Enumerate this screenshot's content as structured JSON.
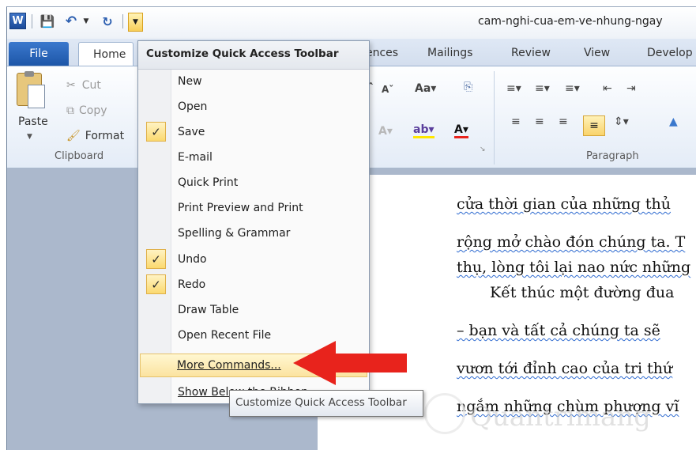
{
  "title_bar": {
    "doc_title": "cam-nghi-cua-em-ve-nhung-ngay"
  },
  "tabs": {
    "file": "File",
    "home": "Home",
    "references_partial": "ences",
    "mailings": "Mailings",
    "review": "Review",
    "view": "View",
    "developer_partial": "Develop"
  },
  "clipboard": {
    "paste": "Paste",
    "cut": "Cut",
    "copy": "Copy",
    "format": "Format",
    "group_label": "Clipboard"
  },
  "paragraph": {
    "group_label": "Paragraph"
  },
  "qat_menu": {
    "header": "Customize Quick Access Toolbar",
    "items": [
      {
        "label": "New",
        "checked": false
      },
      {
        "label": "Open",
        "checked": false
      },
      {
        "label": "Save",
        "checked": true
      },
      {
        "label": "E-mail",
        "checked": false
      },
      {
        "label": "Quick Print",
        "checked": false
      },
      {
        "label": "Print Preview and Print",
        "checked": false
      },
      {
        "label": "Spelling & Grammar",
        "checked": false
      },
      {
        "label": "Undo",
        "checked": true
      },
      {
        "label": "Redo",
        "checked": true
      },
      {
        "label": "Draw Table",
        "checked": false
      },
      {
        "label": "Open Recent File",
        "checked": false
      },
      {
        "label": "More Commands...",
        "checked": false,
        "highlighted": true
      },
      {
        "label": "Show Below the Ribbon",
        "checked": false
      }
    ]
  },
  "tooltip": {
    "text": "Customize Quick Access Toolbar"
  },
  "document": {
    "lines": [
      "cửa thời gian của những thủ",
      "rộng mở chào đón chúng ta. T",
      "thụ, lòng tôi lại nao nức những",
      "Kết thúc một đường đua",
      "– bạn và tất cả chúng ta sẽ",
      "vươn tới đỉnh cao của tri thứ",
      "ngắm những chùm phượng vĩ"
    ]
  },
  "watermark": {
    "text": "Quantrimang"
  },
  "colors": {
    "accent_highlight": "#fbd96f",
    "file_tab": "#1d56a8",
    "arrow": "#e8231c"
  }
}
